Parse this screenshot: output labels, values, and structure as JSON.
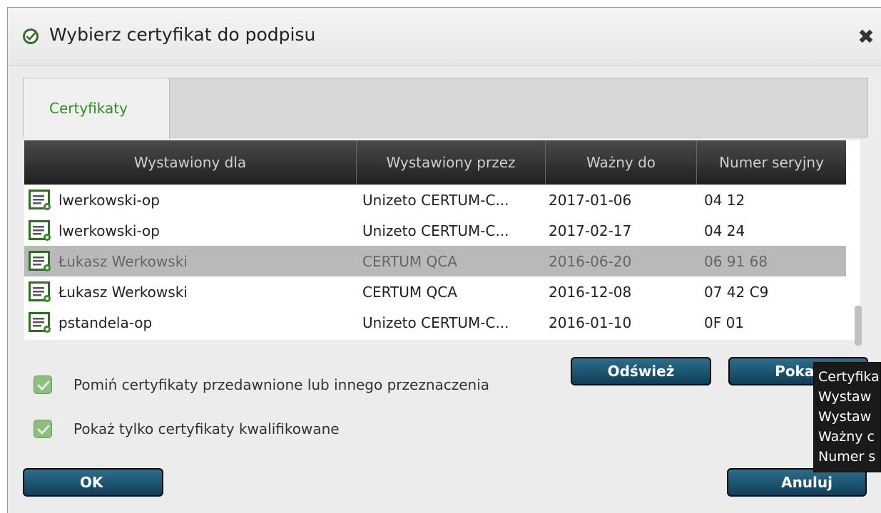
{
  "window": {
    "title": "Wybierz certyfikat do podpisu",
    "close_glyph": "✖",
    "accent_color": "#2f8f1f"
  },
  "tabs": [
    {
      "label": "Certyfikaty",
      "active": true
    }
  ],
  "table": {
    "columns": [
      "Wystawiony dla",
      "Wystawiony przez",
      "Ważny do",
      "Numer seryjny"
    ],
    "rows": [
      {
        "name": "lwerkowski-op",
        "issuer": "Unizeto CERTUM-C...",
        "valid_to": "2017-01-06",
        "serial": "04 12",
        "selected": false
      },
      {
        "name": "lwerkowski-op",
        "issuer": "Unizeto CERTUM-C...",
        "valid_to": "2017-02-17",
        "serial": "04 24",
        "selected": false
      },
      {
        "name": "Łukasz Werkowski",
        "issuer": "CERTUM QCA",
        "valid_to": "2016-06-20",
        "serial": "06 91 68",
        "selected": true
      },
      {
        "name": "Łukasz Werkowski",
        "issuer": "CERTUM QCA",
        "valid_to": "2016-12-08",
        "serial": "07 42 C9",
        "selected": false
      },
      {
        "name": "pstandela-op",
        "issuer": "Unizeto CERTUM-C...",
        "valid_to": "2016-01-10",
        "serial": "0F 01",
        "selected": false
      }
    ]
  },
  "options": {
    "skip_expired": {
      "label": "Pomiń certyfikaty przedawnione lub innego przeznaczenia",
      "checked": true
    },
    "qualified_only": {
      "label": "Pokaż tylko certyfikaty kwalifikowane",
      "checked": true
    }
  },
  "buttons": {
    "refresh": "Odśwież",
    "show": "Pokaż",
    "ok": "OK",
    "cancel": "Anuluj"
  },
  "tooltip": {
    "lines": [
      "Certyfika",
      "Wystaw",
      "Wystaw",
      "Ważny c",
      "Numer s"
    ]
  },
  "icons": {
    "title": "check-badge-icon",
    "row": "certificate-icon",
    "close": "close-icon",
    "checkbox": "check-icon"
  }
}
